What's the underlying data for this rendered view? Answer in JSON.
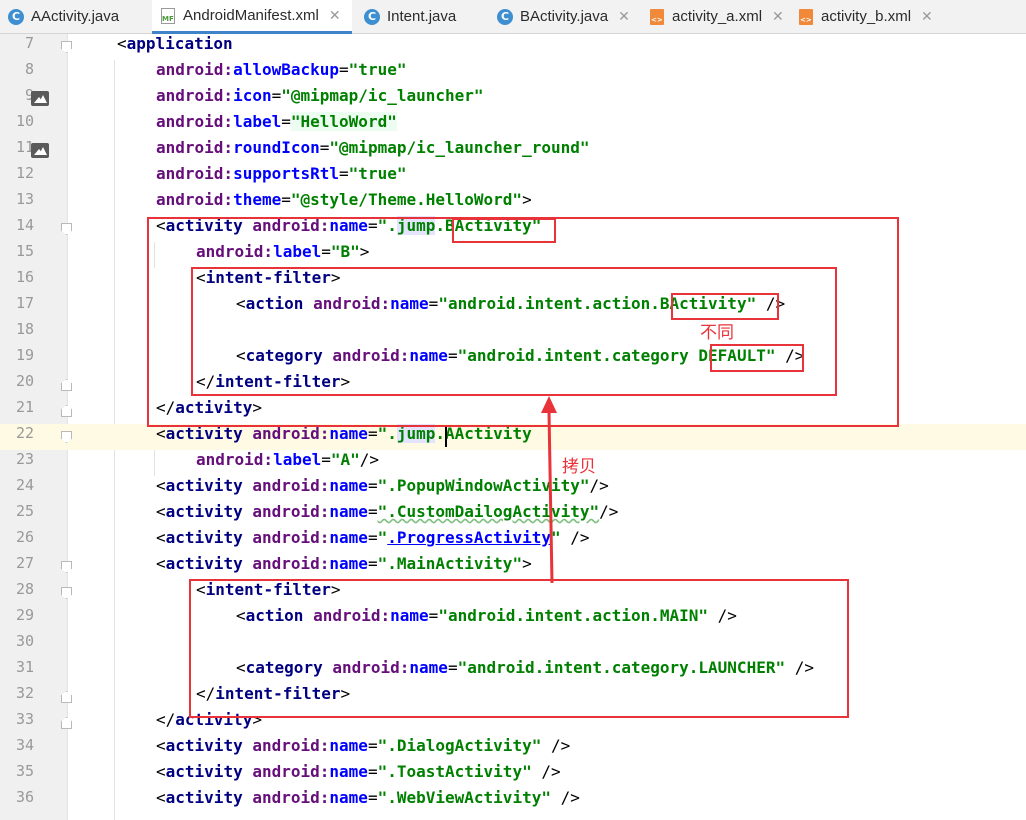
{
  "tabs": [
    {
      "label": "AActivity.java",
      "icon": "class-c-icon",
      "active": false
    },
    {
      "label": "AndroidManifest.xml",
      "icon": "manifest-file-icon",
      "active": true
    },
    {
      "label": "Intent.java",
      "icon": "class-c-icon",
      "active": false
    },
    {
      "label": "BActivity.java",
      "icon": "class-c-icon",
      "active": false
    },
    {
      "label": "activity_a.xml",
      "icon": "layout-xml-icon",
      "active": false
    },
    {
      "label": "activity_b.xml",
      "icon": "layout-xml-icon",
      "active": false
    }
  ],
  "tab_close_glyph": "✕",
  "icon_glyphs": {
    "class": "C",
    "manifest": "MF",
    "xml": "<>"
  },
  "gutter": {
    "line_numbers": [
      "7",
      "8",
      "9",
      "10",
      "11",
      "12",
      "13",
      "14",
      "15",
      "16",
      "17",
      "18",
      "19",
      "20",
      "21",
      "22",
      "23",
      "24",
      "25",
      "26",
      "27",
      "28",
      "29",
      "30",
      "31",
      "32",
      "33",
      "34",
      "35",
      "36"
    ],
    "current_line": "22"
  },
  "code": {
    "l7": {
      "lt": "<",
      "tag": "application"
    },
    "l8": {
      "ns": "android:",
      "attr": "allowBackup",
      "eq": "=",
      "val": "\"true\""
    },
    "l9": {
      "ns": "android:",
      "attr": "icon",
      "eq": "=",
      "val": "\"@mipmap/ic_launcher\""
    },
    "l10": {
      "ns": "android:",
      "attr": "label",
      "eq": "=",
      "val": "\"HelloWord\""
    },
    "l11": {
      "ns": "android:",
      "attr": "roundIcon",
      "eq": "=",
      "val": "\"@mipmap/ic_launcher_round\""
    },
    "l12": {
      "ns": "android:",
      "attr": "supportsRtl",
      "eq": "=",
      "val": "\"true\""
    },
    "l13": {
      "ns": "android:",
      "attr": "theme",
      "eq": "=",
      "val": "\"@style/Theme.HelloWord\"",
      "end": ">"
    },
    "l14": {
      "lt": "<",
      "tag": "activity",
      "ns": " android:",
      "attr": "name",
      "eq": "=",
      "v1": "\".",
      "v2": "jump",
      "v3": ".",
      "v4": "BActivity\""
    },
    "l15": {
      "ns": "android:",
      "attr": "label",
      "eq": "=",
      "val": "\"B\"",
      "end": ">"
    },
    "l16": {
      "lt": "<",
      "tag": "intent-filter",
      "gt": ">"
    },
    "l17": {
      "lt": "<",
      "tag": "action",
      "ns": " android:",
      "attr": "name",
      "eq": "=",
      "v1": "\"android.intent.action.",
      "v2": "BActivity\"",
      "end": " />"
    },
    "l19": {
      "lt": "<",
      "tag": "category",
      "ns": " android:",
      "attr": "name",
      "eq": "=",
      "v1": "\"android.intent.category ",
      "v2": "DEFAULT\"",
      "end": " />"
    },
    "l20": {
      "lt": "</",
      "tag": "intent-filter",
      "gt": ">"
    },
    "l21": {
      "lt": "</",
      "tag": "activity",
      "gt": ">"
    },
    "l22": {
      "lt": "<",
      "tag": "activity",
      "ns": " android:",
      "attr": "name",
      "eq": "=",
      "v1": "\".",
      "v2": "jump",
      "v3": ".AActivity"
    },
    "l23": {
      "ns": "android:",
      "attr": "label",
      "eq": "=",
      "val": "\"A\"",
      "end": "/>"
    },
    "l24": {
      "lt": "<",
      "tag": "activity",
      "ns": " android:",
      "attr": "name",
      "eq": "=",
      "val": "\".PopupWindowActivity\"",
      "end": "/>"
    },
    "l25": {
      "lt": "<",
      "tag": "activity",
      "ns": " android:",
      "attr": "name",
      "eq": "=",
      "v1": "\".CustomDailogActivity\"",
      "end": "/>"
    },
    "l26": {
      "lt": "<",
      "tag": "activity",
      "ns": " android:",
      "attr": "name",
      "eq": "=",
      "v1": "\"",
      "v2": ".ProgressActivity",
      "v3": "\"",
      "end": " />"
    },
    "l27": {
      "lt": "<",
      "tag": "activity",
      "ns": " android:",
      "attr": "name",
      "eq": "=",
      "val": "\".MainActivity\"",
      "end": ">"
    },
    "l28": {
      "lt": "<",
      "tag": "intent-filter",
      "gt": ">"
    },
    "l29": {
      "lt": "<",
      "tag": "action",
      "ns": " android:",
      "attr": "name",
      "eq": "=",
      "val": "\"android.intent.action.MAIN\"",
      "end": " />"
    },
    "l31": {
      "lt": "<",
      "tag": "category",
      "ns": " android:",
      "attr": "name",
      "eq": "=",
      "val": "\"android.intent.category.LAUNCHER\"",
      "end": " />"
    },
    "l32": {
      "lt": "</",
      "tag": "intent-filter",
      "gt": ">"
    },
    "l33": {
      "lt": "</",
      "tag": "activity",
      "gt": ">"
    },
    "l34": {
      "lt": "<",
      "tag": "activity",
      "ns": " android:",
      "attr": "name",
      "eq": "=",
      "val": "\".DialogActivity\"",
      "end": " />"
    },
    "l35": {
      "lt": "<",
      "tag": "activity",
      "ns": " android:",
      "attr": "name",
      "eq": "=",
      "val": "\".ToastActivity\"",
      "end": " />"
    },
    "l36": {
      "lt": "<",
      "tag": "activity",
      "ns": " android:",
      "attr": "name",
      "eq": "=",
      "val": "\".WebViewActivity\"",
      "end": " />"
    }
  },
  "annotations": {
    "diff_label": "不同",
    "copy_label": "拷贝",
    "color": "#e8333a"
  },
  "colors": {
    "tag": "#000080",
    "namespace": "#660e7a",
    "attribute": "#0000ff",
    "value": "#008000",
    "active_tab_underline": "#4083c9",
    "current_line_bg": "#fffae3"
  }
}
